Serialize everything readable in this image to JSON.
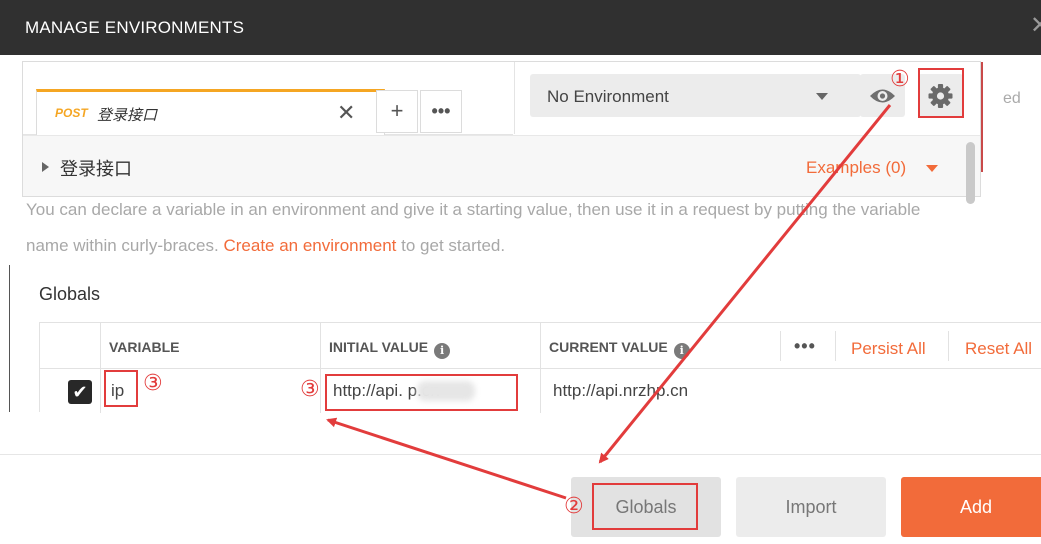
{
  "modal": {
    "title": "MANAGE ENVIRONMENTS",
    "close_glyph": "✕"
  },
  "intro": {
    "line1": "You can declare a variable in an environment and give it a starting value, then use it in a request by putting the variable",
    "line2_prefix": "name within curly-braces. ",
    "line2_link": "Create an environment",
    "line2_suffix": " to get started."
  },
  "globals": {
    "title": "Globals",
    "columns": {
      "variable": "VARIABLE",
      "initial": "INITIAL VALUE",
      "current": "CURRENT VALUE"
    },
    "info_glyph": "i",
    "more_glyph": "•••",
    "persist_all": "Persist All",
    "reset_all": "Reset All",
    "rows": [
      {
        "checked": true,
        "variable": "ip",
        "initial": "http://api.   p.cn",
        "current": "http://api.nrzhp.cn"
      }
    ]
  },
  "footer": {
    "globals_btn": "Globals",
    "import_btn": "Import",
    "add_btn": "Add"
  },
  "builder": {
    "tab": {
      "method": "POST",
      "title": "登录接口",
      "close_glyph": "✕"
    },
    "add_tab_glyph": "+",
    "more_glyph": "•••",
    "environment": {
      "selected": "No Environment"
    },
    "breadcrumb": "登录接口",
    "examples": "Examples (0)",
    "ghost_text": "ed"
  },
  "annotations": {
    "n1": "①",
    "n2": "②",
    "n3": "③"
  },
  "colors": {
    "accent": "#f26b3a",
    "method": "#f5a623",
    "annotation": "#e23c3c",
    "header": "#303030"
  }
}
